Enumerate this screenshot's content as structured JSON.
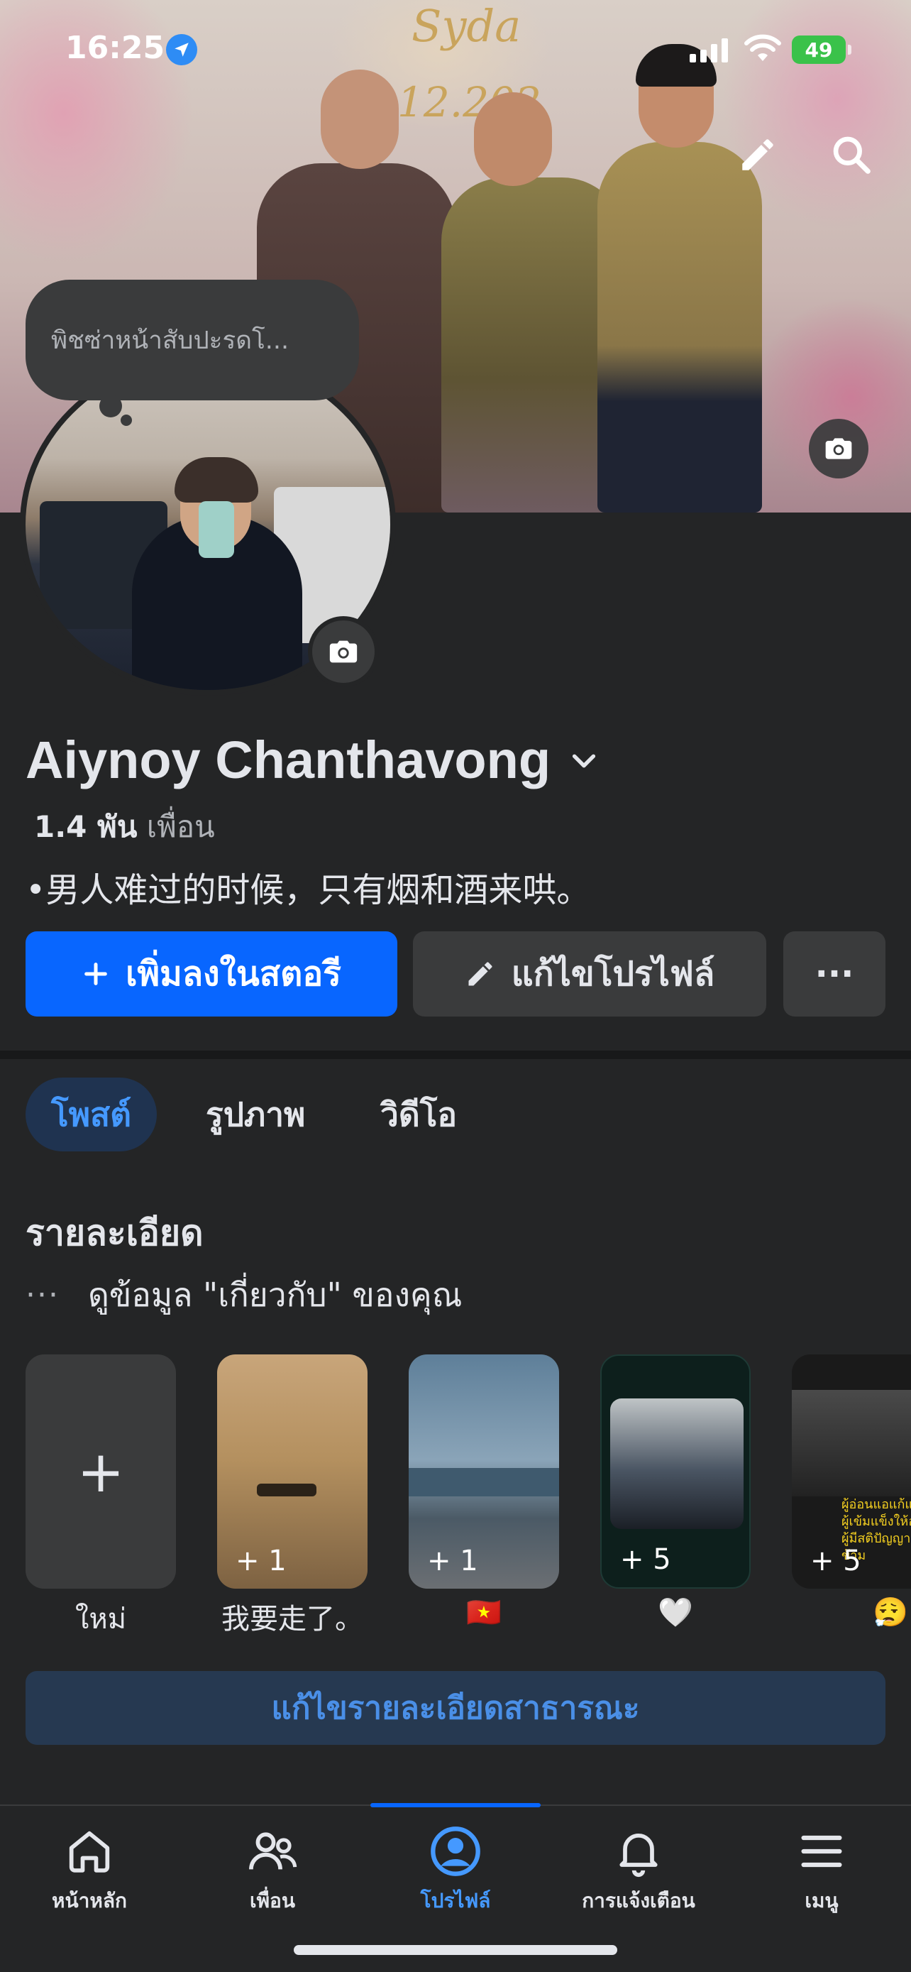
{
  "status_bar": {
    "time": "16:25",
    "battery": "49"
  },
  "cover": {
    "backdrop_text": "12.202",
    "backdrop_script": "Syda"
  },
  "note": {
    "text": "พิชซ่าหน้าสับปะรดโ..."
  },
  "profile": {
    "name": "Aiynoy Chanthavong",
    "friends_count": "1.4 พัน",
    "friends_label": "เพื่อน",
    "bio": "•男人难过的时候，只有烟和酒来哄。"
  },
  "actions": {
    "add_story": "เพิ่มลงในสตอรี",
    "edit_profile": "แก้ไขโปรไฟล์",
    "more": "···"
  },
  "tabs": [
    {
      "label": "โพสต์",
      "active": true
    },
    {
      "label": "รูปภาพ",
      "active": false
    },
    {
      "label": "วิดีโอ",
      "active": false
    }
  ],
  "details": {
    "heading": "รายละเอียด",
    "about_dots": "···",
    "about_text": "ดูข้อมูล \"เกี่ยวกับ\" ของคุณ"
  },
  "highlights": [
    {
      "label": "ใหม่",
      "plus": "+"
    },
    {
      "label": "我要走了。",
      "count": "+ 1"
    },
    {
      "label": "🇻🇳",
      "count": "+ 1"
    },
    {
      "label": "🤍",
      "count": "+ 5"
    },
    {
      "label": "😮‍💨",
      "count": "+ 5",
      "overlay_text": "ผู้อ่อนแอแก้แค้น ผู้เข้มแข็งให้อภัย ผู้มีสติปัญญามองข้าม"
    }
  ],
  "edit_details_button": "แก้ไขรายละเอียดสาธารณะ",
  "bottom_nav": [
    {
      "label": "หน้าหลัก",
      "icon": "home-icon"
    },
    {
      "label": "เพื่อน",
      "icon": "friends-icon"
    },
    {
      "label": "โปรไฟล์",
      "icon": "profile-icon",
      "active": true
    },
    {
      "label": "การแจ้งเตือน",
      "icon": "bell-icon"
    },
    {
      "label": "เมนู",
      "icon": "menu-icon"
    }
  ],
  "colors": {
    "background": "#242526",
    "accent": "#0866ff",
    "active_text": "#4599ff",
    "surface": "#3a3b3c"
  }
}
